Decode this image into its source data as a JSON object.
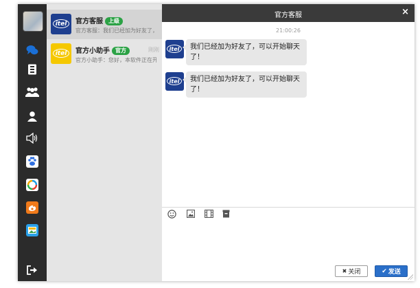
{
  "window": {
    "title": "官方客服",
    "close_glyph": "×"
  },
  "sidebar": {
    "icons": [
      "avatar",
      "chat-bubbles-icon",
      "contacts-book-icon",
      "group-icon",
      "person-icon",
      "speaker-icon",
      "paw-icon",
      "refresh-app-icon",
      "weibo-icon",
      "image-app-icon",
      "logout-icon"
    ],
    "accent": "#1a6fd6"
  },
  "conversations": [
    {
      "name": "官方客服",
      "tag": "上级",
      "time": "",
      "preview": "官方客服：我们已经加为好友了，可以开始聊天了！",
      "logo_text": "itel",
      "logo_color": "#1e3f8f"
    },
    {
      "name": "官方小助手",
      "tag": "官方",
      "time": "刚刚",
      "preview": "官方小助手：您好，本软件正在开发中",
      "logo_text": "itel",
      "logo_color": "#f5c800"
    }
  ],
  "chat": {
    "timestamp": "21:00:26",
    "messages": [
      {
        "text": "我们已经加为好友了，可以开始聊天了！",
        "avatar_text": "itel"
      },
      {
        "text": "我们已经加为好友了，可以开始聊天了！",
        "avatar_text": "itel"
      }
    ],
    "toolbar": [
      "emoji-icon",
      "image-icon",
      "video-icon",
      "file-icon"
    ],
    "close_label": "关闭",
    "send_label": "发送",
    "close_glyph": "✖",
    "send_glyph": "✔"
  }
}
